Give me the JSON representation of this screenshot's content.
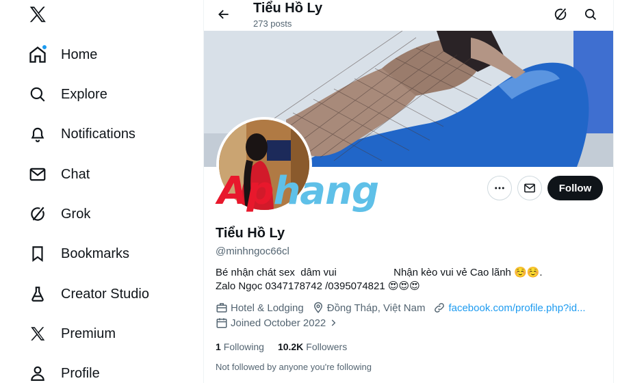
{
  "sidebar": {
    "logo": "x-logo-icon",
    "items": [
      {
        "label": "Home",
        "icon": "home-icon"
      },
      {
        "label": "Explore",
        "icon": "search-icon"
      },
      {
        "label": "Notifications",
        "icon": "bell-icon"
      },
      {
        "label": "Chat",
        "icon": "mail-icon"
      },
      {
        "label": "Grok",
        "icon": "grok-icon"
      },
      {
        "label": "Bookmarks",
        "icon": "bookmark-icon"
      },
      {
        "label": "Creator Studio",
        "icon": "flask-icon"
      },
      {
        "label": "Premium",
        "icon": "x-premium-icon"
      },
      {
        "label": "Profile",
        "icon": "person-icon"
      }
    ]
  },
  "header": {
    "name": "Tiểu Hồ Ly",
    "post_count": "273 posts"
  },
  "watermark": {
    "part1": "Ap",
    "part2": "hang"
  },
  "actions": {
    "follow_label": "Follow"
  },
  "profile": {
    "name": "Tiểu Hồ Ly",
    "handle": "@minhngoc66cl",
    "bio_line1": "Bé nhận chát sex  dâm vui                    Nhận kèo vui vẻ Cao lãnh ☺️☺️.",
    "bio_line2": "Zalo Ngọc 0347178742 /0395074821 😍😍😍",
    "category": "Hotel & Lodging",
    "location": "Đồng Tháp, Việt Nam",
    "link": "facebook.com/profile.php?id...",
    "joined": "Joined October 2022",
    "following_count": "1",
    "following_label": "Following",
    "followers_count": "10.2K",
    "followers_label": "Followers",
    "not_followed": "Not followed by anyone you're following"
  },
  "colors": {
    "accent": "#1d9bf0",
    "text_primary": "#0f1419",
    "text_secondary": "#536471",
    "watermark_red": "#e8182c",
    "watermark_blue": "#5fc0e8"
  }
}
